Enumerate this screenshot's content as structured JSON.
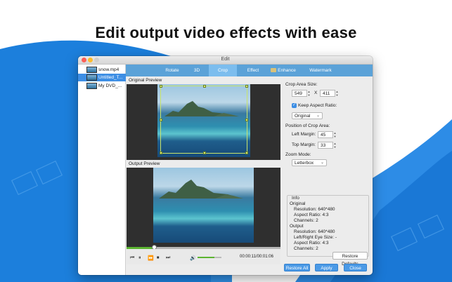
{
  "headline": "Edit output video effects with ease",
  "window": {
    "title": "Edit"
  },
  "files": [
    {
      "name": "snow.mp4",
      "selected": false
    },
    {
      "name": "Untitled_T...",
      "selected": true
    },
    {
      "name": "My DVD_...",
      "selected": false
    }
  ],
  "tabs": [
    {
      "label": "Rotate",
      "active": false
    },
    {
      "label": "3D",
      "active": false
    },
    {
      "label": "Crop",
      "active": true
    },
    {
      "label": "Effect",
      "active": false
    },
    {
      "label": "Enhance",
      "active": false,
      "icon": "enhance-icon"
    },
    {
      "label": "Watermark",
      "active": false
    }
  ],
  "preview": {
    "original_label": "Original Preview",
    "output_label": "Output Preview",
    "playback_progress": 0.18,
    "volume": 0.7,
    "timecode": "00:00:11/00:01:06"
  },
  "crop": {
    "area_size_label": "Crop Area Size:",
    "width": "549",
    "times": "X",
    "height": "411",
    "keep_aspect_label": "Keep Aspect Ratio:",
    "keep_aspect_checked": true,
    "aspect_value": "Original",
    "position_label": "Position of Crop Area:",
    "left_margin_label": "Left Margin:",
    "left_margin": "45",
    "top_margin_label": "Top Margin:",
    "top_margin": "33",
    "zoom_mode_label": "Zoom Mode:",
    "zoom_mode": "Letterbox"
  },
  "info": {
    "title": "Info",
    "original_heading": "Original",
    "original": [
      "Resolution: 640*480",
      "Aspect Ratio: 4:3",
      "Channels: 2"
    ],
    "output_heading": "Output",
    "output": [
      "Resolution: 640*480",
      "Left/Right Eye Size: -",
      "Aspect Ratio: 4:3",
      "Channels: 2"
    ]
  },
  "buttons": {
    "restore_defaults": "Restore Defaults",
    "restore_all": "Restore All",
    "apply": "Apply",
    "close": "Close"
  },
  "colors": {
    "accent": "#3d8ee4",
    "tab_bar": "#5ba2d8",
    "background_wave": "#1f86e0"
  }
}
